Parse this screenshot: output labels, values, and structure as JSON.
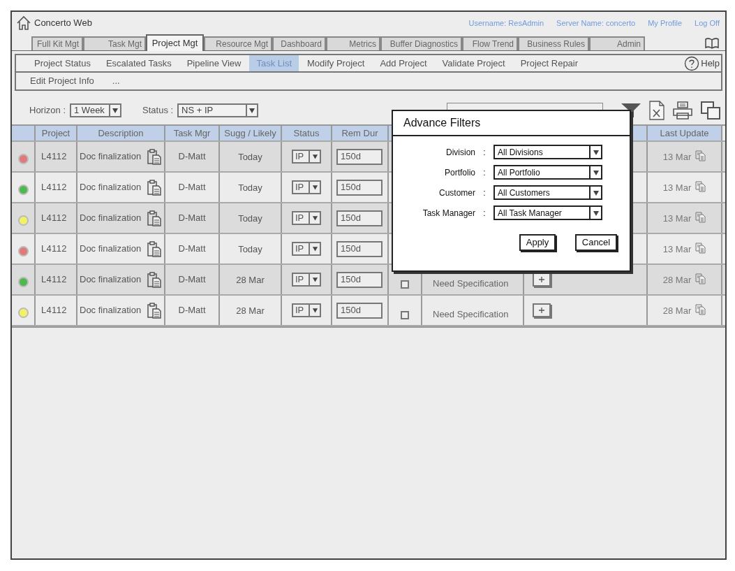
{
  "app": {
    "title": "Concerto Web"
  },
  "user_links": [
    {
      "label": "Username: ResAdmin"
    },
    {
      "label": "Server Name: concerto"
    },
    {
      "label": "My Profile"
    },
    {
      "label": "Log Off"
    }
  ],
  "tabs": [
    {
      "label": "Full Kit Mgt",
      "selected": false
    },
    {
      "label": "Task Mgt",
      "selected": false
    },
    {
      "label": "Project Mgt",
      "selected": true
    },
    {
      "label": "Resource Mgt",
      "selected": false
    },
    {
      "label": "Dashboard",
      "selected": false
    },
    {
      "label": "Metrics",
      "selected": false
    },
    {
      "label": "Buffer Diagnostics",
      "selected": false
    },
    {
      "label": "Flow Trend",
      "selected": false
    },
    {
      "label": "Business Rules",
      "selected": false
    },
    {
      "label": "Admin",
      "selected": false
    }
  ],
  "subnav": [
    {
      "label": "Project Status",
      "selected": false
    },
    {
      "label": "Escalated Tasks",
      "selected": false
    },
    {
      "label": "Pipeline View",
      "selected": false
    },
    {
      "label": "Task List",
      "selected": true
    },
    {
      "label": "Modify Project",
      "selected": false
    },
    {
      "label": "Add Project",
      "selected": false
    },
    {
      "label": "Validate Project",
      "selected": false
    },
    {
      "label": "Project Repair",
      "selected": false
    }
  ],
  "subnav_row2": [
    {
      "label": "Edit Project Info"
    },
    {
      "label": "..."
    }
  ],
  "help": {
    "label": "Help"
  },
  "filters": [
    {
      "label": "Horizon :",
      "value": "1 Week"
    },
    {
      "label": "Status :",
      "value": "NS + IP"
    }
  ],
  "table": {
    "columns": [
      "Project",
      "Description",
      "Task Mgr",
      "Sugg / Likely",
      "Status",
      "Rem Dur",
      "Last Update"
    ],
    "rows": [
      {
        "color": "#e07a7a",
        "project": "L4112",
        "description": "Doc finalization",
        "task_mgr": "D-Matt",
        "date": "Today",
        "status": "IP",
        "rem_dur": "150d",
        "last_update": "13 Mar"
      },
      {
        "color": "#4fb84f",
        "project": "L4112",
        "description": "Doc finalization",
        "task_mgr": "D-Matt",
        "date": "Today",
        "status": "IP",
        "rem_dur": "150d",
        "last_update": "13 Mar"
      },
      {
        "color": "#f2f266",
        "project": "L4112",
        "description": "Doc finalization",
        "task_mgr": "D-Matt",
        "date": "Today",
        "status": "IP",
        "rem_dur": "150d",
        "last_update": "13 Mar"
      },
      {
        "color": "#e07a7a",
        "project": "L4112",
        "description": "Doc finalization",
        "task_mgr": "D-Matt",
        "date": "Today",
        "status": "IP",
        "rem_dur": "150d",
        "last_update": "13 Mar"
      },
      {
        "color": "#4fb84f",
        "project": "L4112",
        "description": "Doc finalization",
        "task_mgr": "D-Matt",
        "date": "28 Mar",
        "status": "IP",
        "rem_dur": "150d",
        "checked": false,
        "note": "Need Specification",
        "last_update": "28 Mar"
      },
      {
        "color": "#f2f266",
        "project": "L4112",
        "description": "Doc finalization",
        "task_mgr": "D-Matt",
        "date": "28 Mar",
        "status": "IP",
        "rem_dur": "150d",
        "checked": false,
        "note": "Need Specification",
        "last_update": "28 Mar"
      }
    ]
  },
  "dialog": {
    "title": "Advance Filters",
    "fields": [
      {
        "label": "Division",
        "separator": ":",
        "value": "All Divisions"
      },
      {
        "label": "Portfolio",
        "separator": ":",
        "value": "All Portfolio"
      },
      {
        "label": "Customer",
        "separator": ":",
        "value": "All Customers"
      },
      {
        "label": "Task Manager",
        "separator": ":",
        "value": "All Task Manager"
      }
    ],
    "buttons": [
      "Apply",
      "Cancel"
    ]
  }
}
